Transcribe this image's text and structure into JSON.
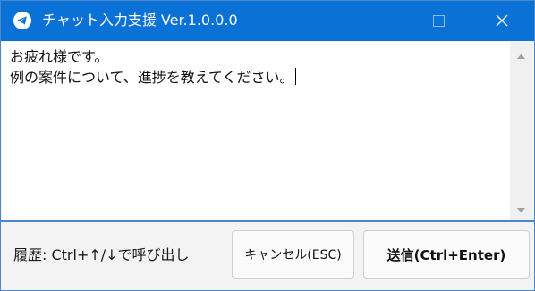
{
  "window": {
    "title": "チャット入力支援 Ver.1.0.0.0",
    "app_icon": "telegram-paper-plane-icon",
    "controls": [
      "minimize-icon",
      "maximize-icon",
      "close-icon"
    ],
    "accent_color": "#0a72d6"
  },
  "editor": {
    "line1": "お疲れ様です。",
    "line2": "例の案件について、進捗を教えてください。"
  },
  "footer": {
    "history_hint": "履歴: Ctrl+↑/↓で呼び出し",
    "cancel_label": "キャンセル(ESC)",
    "send_label": "送信(Ctrl+Enter)"
  }
}
